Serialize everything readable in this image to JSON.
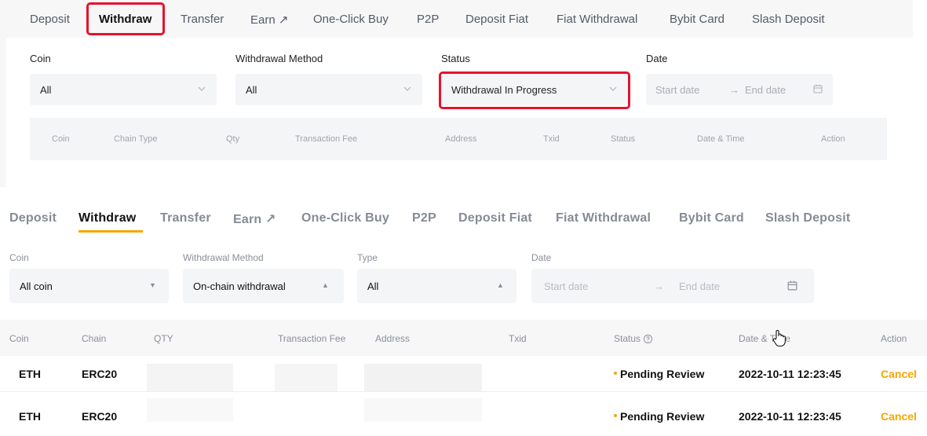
{
  "top": {
    "tabs": [
      {
        "label": "Deposit"
      },
      {
        "label": "Withdraw"
      },
      {
        "label": "Transfer"
      },
      {
        "label": "Earn ↗"
      },
      {
        "label": "One-Click Buy"
      },
      {
        "label": "P2P"
      },
      {
        "label": "Deposit Fiat"
      },
      {
        "label": "Fiat Withdrawal"
      },
      {
        "label": "Bybit Card"
      },
      {
        "label": "Slash Deposit"
      }
    ],
    "filters": {
      "coin": {
        "label": "Coin",
        "value": "All"
      },
      "method": {
        "label": "Withdrawal Method",
        "value": "All"
      },
      "status": {
        "label": "Status",
        "value": "Withdrawal In Progress"
      },
      "date": {
        "label": "Date",
        "start_placeholder": "Start date",
        "arrow": "→",
        "end_placeholder": "End date"
      }
    },
    "table_headers": [
      "Coin",
      "Chain Type",
      "Qty",
      "Transaction Fee",
      "Address",
      "Txid",
      "Status",
      "Date & Time",
      "Action"
    ]
  },
  "bottom": {
    "tabs": [
      {
        "label": "Deposit"
      },
      {
        "label": "Withdraw"
      },
      {
        "label": "Transfer"
      },
      {
        "label": "Earn ↗"
      },
      {
        "label": "One-Click Buy"
      },
      {
        "label": "P2P"
      },
      {
        "label": "Deposit Fiat"
      },
      {
        "label": "Fiat Withdrawal"
      },
      {
        "label": "Bybit Card"
      },
      {
        "label": "Slash Deposit"
      }
    ],
    "filters": {
      "coin": {
        "label": "Coin",
        "value": "All coin"
      },
      "method": {
        "label": "Withdrawal Method",
        "value": "On-chain withdrawal"
      },
      "type": {
        "label": "Type",
        "value": "All"
      },
      "date": {
        "label": "Date",
        "start_placeholder": "Start date",
        "arrow": "→",
        "end_placeholder": "End date"
      }
    },
    "table_headers": [
      "Coin",
      "Chain",
      "QTY",
      "Transaction Fee",
      "Address",
      "Txid",
      "Status",
      "Date & Time",
      "Action"
    ],
    "rows": [
      {
        "coin": "ETH",
        "chain": "ERC20",
        "status": "Pending Review",
        "datetime": "2022-10-11 12:23:45",
        "action": "Cancel"
      },
      {
        "coin": "ETH",
        "chain": "ERC20",
        "status": "Pending Review",
        "datetime": "2022-10-11 12:23:45",
        "action": "Cancel"
      }
    ]
  },
  "colors": {
    "accent": "#f7a600",
    "highlight": "#e8112d"
  },
  "icons": [
    "external-link-icon",
    "chevron-down-icon",
    "caret-down-icon",
    "caret-up-icon",
    "calendar-icon",
    "help-circle-icon",
    "hand-cursor-icon"
  ]
}
